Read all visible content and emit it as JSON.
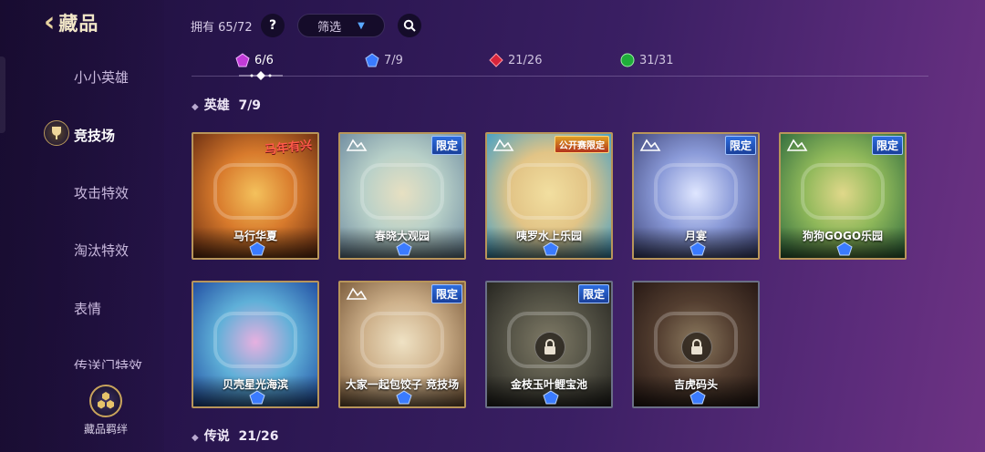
{
  "header": {
    "back_label": "藏品",
    "owned_text": "拥有 65/72",
    "help_label": "?",
    "filter_label": "筛选"
  },
  "sidebar": {
    "items": [
      {
        "label": "小小英雄"
      },
      {
        "label": "竞技场"
      },
      {
        "label": "攻击特效"
      },
      {
        "label": "淘汰特效"
      },
      {
        "label": "表情"
      },
      {
        "label": "传送门特效"
      }
    ],
    "active_index": 1,
    "bond_label": "藏品羁绊"
  },
  "tabs": [
    {
      "count": "6/6",
      "gem_color": "#c23bd8"
    },
    {
      "count": "7/9",
      "gem_color": "#3a7bff"
    },
    {
      "count": "21/26",
      "gem_color": "#d8243a"
    },
    {
      "count": "31/31",
      "gem_color": "#1fae3a"
    }
  ],
  "sections": {
    "heroes_title": "英雄",
    "heroes_count": "7/9",
    "legend_title": "传说",
    "legend_count": "21/26"
  },
  "cards": [
    {
      "name": "马行华夏",
      "badge": "",
      "brand": "马年有兴",
      "locked": false,
      "colors": [
        "#6b2e12",
        "#d87a2c",
        "#f4c15c"
      ]
    },
    {
      "name": "春晓大观园",
      "badge": "限定",
      "brand": "",
      "locked": false,
      "colors": [
        "#6e8ba0",
        "#b8d0c8",
        "#e7e0c2"
      ]
    },
    {
      "name": "咦罗水上乐园",
      "badge": "公开赛限定",
      "brand": "",
      "locked": false,
      "colors": [
        "#3d9fc9",
        "#e2c486",
        "#f2dfa0"
      ]
    },
    {
      "name": "月宴",
      "badge": "限定",
      "brand": "",
      "locked": false,
      "colors": [
        "#40467a",
        "#8a9ad8",
        "#dfe6ff"
      ]
    },
    {
      "name": "狗狗GOGO乐园",
      "badge": "限定",
      "brand": "",
      "locked": false,
      "colors": [
        "#2e6a3e",
        "#8fb85a",
        "#e0d88a"
      ]
    },
    {
      "name": "贝壳星光海滨",
      "badge": "",
      "brand": "",
      "locked": false,
      "colors": [
        "#1f4aa0",
        "#5fb0d8",
        "#e7b0e0"
      ]
    },
    {
      "name": "大家一起包饺子 竞技场",
      "badge": "限定",
      "brand": "",
      "locked": false,
      "colors": [
        "#7a5a3a",
        "#cdb08a",
        "#efe2c4"
      ]
    },
    {
      "name": "金枝玉叶鲤宝池",
      "badge": "限定",
      "brand": "",
      "locked": true,
      "colors": [
        "#2d2c22",
        "#6e6a4c",
        "#a59a6c"
      ]
    },
    {
      "name": "吉虎码头",
      "badge": "",
      "brand": "",
      "locked": true,
      "colors": [
        "#3a1a12",
        "#7a4a2a",
        "#c0965a"
      ]
    }
  ],
  "colors": {
    "gold_border": "#b8955a",
    "locked_border": "#6a6f86",
    "gem_blue": "#3a7bff"
  }
}
